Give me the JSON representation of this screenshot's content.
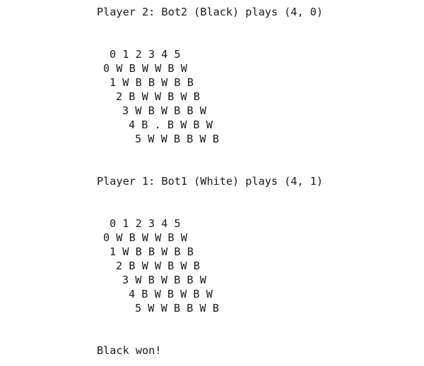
{
  "console": {
    "move1": {
      "announcement": "Player 2: Bot2 (Black) plays (4, 0)",
      "board": {
        "header": "0 1 2 3 4 5",
        "rows": [
          "0 W B W W B W",
          "1 W B B W B B",
          "2 B W W B W B",
          "3 W B W B B W",
          "4 B . B W B W",
          "5 W W B B W B"
        ]
      }
    },
    "move2": {
      "announcement": "Player 1: Bot1 (White) plays (4, 1)",
      "board": {
        "header": "0 1 2 3 4 5",
        "rows": [
          "0 W B W W B W",
          "1 W B B W B B",
          "2 B W W B W B",
          "3 W B W B B W",
          "4 B W B W B W",
          "5 W W B B W B"
        ]
      }
    },
    "result": "Black won!"
  }
}
